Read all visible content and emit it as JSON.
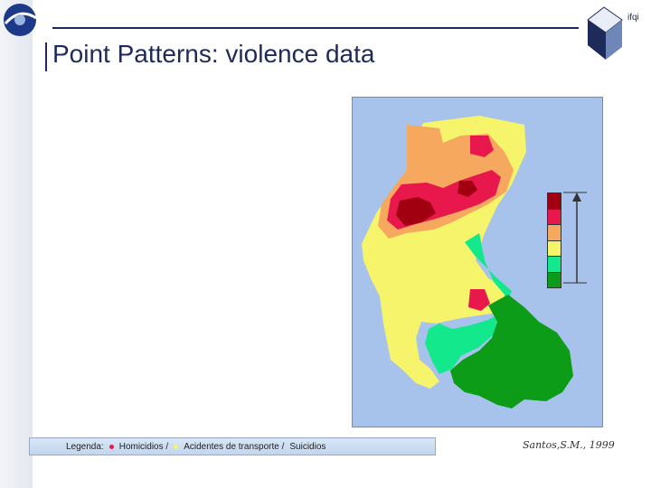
{
  "header": {
    "title": "Point Patterns: violence data",
    "brand_text": "ifqi"
  },
  "legend": {
    "label": "Legenda:",
    "item1": "Homicidios /",
    "item2": "Acidentes de transporte /",
    "item3": "Suicidios"
  },
  "source": "Santos,S.M., 1999",
  "colors": {
    "title": "#1e2a5a",
    "map_background": "#a7c3ec",
    "dark_red": "#a00010",
    "red": "#e8184c",
    "orange": "#f7a85f",
    "yellow": "#f6f46a",
    "light_green": "#14e88c",
    "green": "#0d9c18"
  },
  "scale_colors": [
    "#a00010",
    "#e8184c",
    "#f7a85f",
    "#f6f46a",
    "#14e88c",
    "#0d9c18"
  ],
  "icons": {
    "logo": "inpe-logo",
    "brand": "cube-logo",
    "scale_arrow": "arrow-up-icon"
  }
}
